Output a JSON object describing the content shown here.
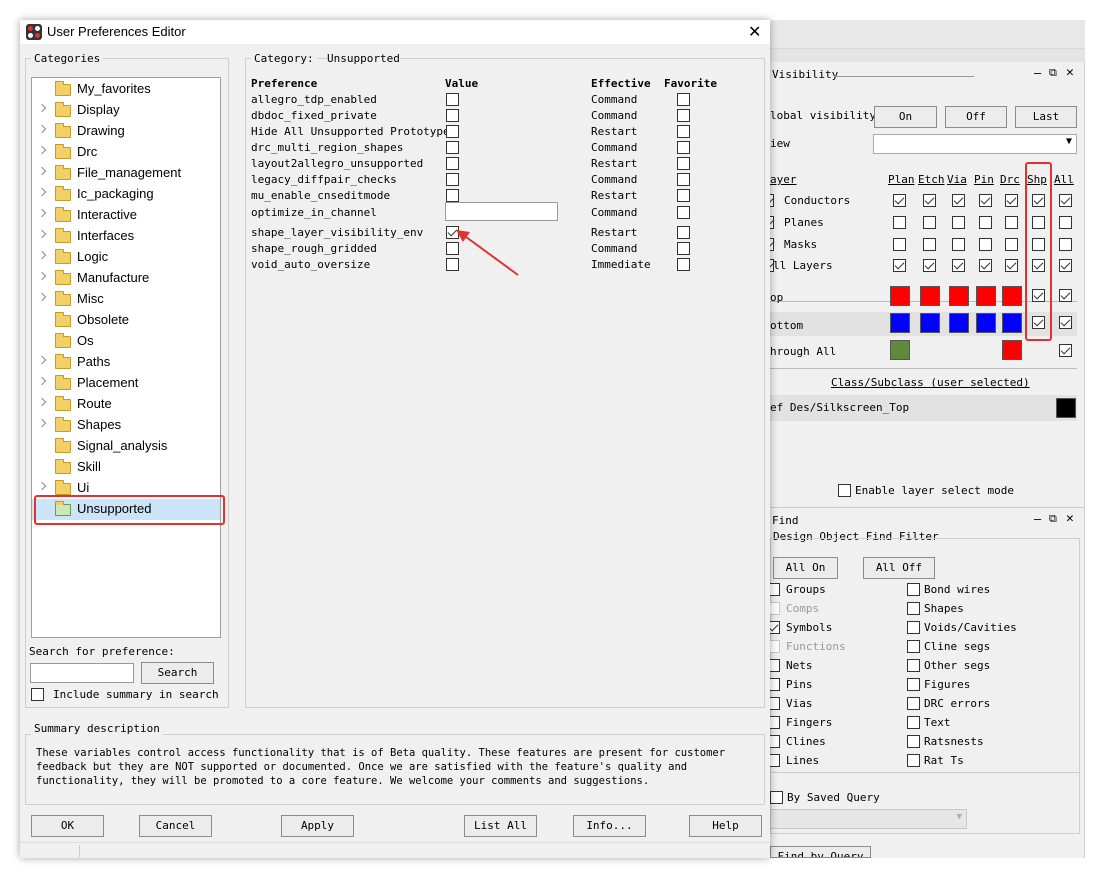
{
  "dialog": {
    "title": "User Preferences Editor",
    "categories_label": "Categories",
    "category_prefix": "Category:",
    "category_value": "Unsupported",
    "tree": [
      {
        "label": "My_favorites",
        "expandable": false
      },
      {
        "label": "Display",
        "expandable": true
      },
      {
        "label": "Drawing",
        "expandable": true
      },
      {
        "label": "Drc",
        "expandable": true
      },
      {
        "label": "File_management",
        "expandable": true
      },
      {
        "label": "Ic_packaging",
        "expandable": true
      },
      {
        "label": "Interactive",
        "expandable": true
      },
      {
        "label": "Interfaces",
        "expandable": true
      },
      {
        "label": "Logic",
        "expandable": true
      },
      {
        "label": "Manufacture",
        "expandable": true
      },
      {
        "label": "Misc",
        "expandable": true
      },
      {
        "label": "Obsolete",
        "expandable": false
      },
      {
        "label": "Os",
        "expandable": false
      },
      {
        "label": "Paths",
        "expandable": true
      },
      {
        "label": "Placement",
        "expandable": true
      },
      {
        "label": "Route",
        "expandable": true
      },
      {
        "label": "Shapes",
        "expandable": true
      },
      {
        "label": "Signal_analysis",
        "expandable": false
      },
      {
        "label": "Skill",
        "expandable": false
      },
      {
        "label": "Ui",
        "expandable": true
      },
      {
        "label": "Unsupported",
        "expandable": false,
        "selected": true
      }
    ],
    "columns": {
      "preference": "Preference",
      "value": "Value",
      "effective": "Effective",
      "favorite": "Favorite"
    },
    "preferences": [
      {
        "name": "allegro_tdp_enabled",
        "value_type": "checkbox",
        "checked": false,
        "effective": "Command"
      },
      {
        "name": "dbdoc_fixed_private",
        "value_type": "checkbox",
        "checked": false,
        "effective": "Command"
      },
      {
        "name": "Hide All Unsupported Prototypes",
        "value_type": "checkbox",
        "checked": false,
        "effective": "Restart"
      },
      {
        "name": "drc_multi_region_shapes",
        "value_type": "checkbox",
        "checked": false,
        "effective": "Command"
      },
      {
        "name": "layout2allegro_unsupported",
        "value_type": "checkbox",
        "checked": false,
        "effective": "Restart"
      },
      {
        "name": "legacy_diffpair_checks",
        "value_type": "checkbox",
        "checked": false,
        "effective": "Command"
      },
      {
        "name": "mu_enable_cnseditmode",
        "value_type": "checkbox",
        "checked": false,
        "effective": "Restart"
      },
      {
        "name": "optimize_in_channel",
        "value_type": "text",
        "value": "",
        "effective": "Command"
      },
      {
        "name": "shape_layer_visibility_env",
        "value_type": "checkbox",
        "checked": true,
        "effective": "Restart"
      },
      {
        "name": "shape_rough_gridded",
        "value_type": "checkbox",
        "checked": false,
        "effective": "Command"
      },
      {
        "name": "void_auto_oversize",
        "value_type": "checkbox",
        "checked": false,
        "effective": "Immediate"
      }
    ],
    "search_label": "Search for preference:",
    "search_value": "",
    "search_button": "Search",
    "include_summary_label": "Include summary in search",
    "summary_title": "Summary description",
    "summary_text": "These variables control access functionality that is of Beta quality. These features are present for customer\nfeedback but they are NOT supported or documented. Once we are satisfied with the feature's quality and\nfunctionality, they will be promoted to a core feature. We welcome your comments and suggestions.",
    "buttons": {
      "ok": "OK",
      "cancel": "Cancel",
      "apply": "Apply",
      "list_all": "List All",
      "info": "Info...",
      "help": "Help"
    }
  },
  "visibility": {
    "title": "Visibility",
    "global_label": "lobal visibility",
    "on": "On",
    "off": "Off",
    "last": "Last",
    "view_label": "iew",
    "layer_header": "ayer",
    "col_headers": [
      "Plan",
      "Etch",
      "Via",
      "Pin",
      "Drc",
      "Shp",
      "All"
    ],
    "rows": [
      {
        "label": "Conductors",
        "checks": [
          true,
          true,
          true,
          true,
          true,
          true,
          true
        ]
      },
      {
        "label": "Planes",
        "checks": [
          false,
          false,
          false,
          false,
          false,
          false,
          false
        ]
      },
      {
        "label": "Masks",
        "checks": [
          false,
          false,
          false,
          false,
          false,
          false,
          false
        ]
      },
      {
        "label": "ll Layers",
        "checks": [
          true,
          true,
          true,
          true,
          true,
          true,
          true
        ]
      }
    ],
    "top_label": "op",
    "bottom_label": "ottom",
    "through_label": "hrough All",
    "top_color": "#ff0000",
    "bottom_color": "#0000ff",
    "through_color": "#5f8a3c",
    "class_subclass": "Class/Subclass (user selected)",
    "ref_des": "ef Des/Silkscreen_Top",
    "enable_layer_select": "Enable layer select mode"
  },
  "find": {
    "title": "Find",
    "filter_title": "Design Object Find Filter",
    "all_on": "All On",
    "all_off": "All Off",
    "left_items": [
      {
        "label": "Groups",
        "checked": false,
        "disabled": false
      },
      {
        "label": "Comps",
        "checked": false,
        "disabled": true
      },
      {
        "label": "Symbols",
        "checked": true,
        "disabled": false
      },
      {
        "label": "Functions",
        "checked": false,
        "disabled": true
      },
      {
        "label": "Nets",
        "checked": false,
        "disabled": false
      },
      {
        "label": "Pins",
        "checked": false,
        "disabled": false
      },
      {
        "label": "Vias",
        "checked": false,
        "disabled": false
      },
      {
        "label": "Fingers",
        "checked": false,
        "disabled": false
      },
      {
        "label": "Clines",
        "checked": false,
        "disabled": false
      },
      {
        "label": "Lines",
        "checked": false,
        "disabled": false
      }
    ],
    "right_items": [
      {
        "label": "Bond wires",
        "checked": false
      },
      {
        "label": "Shapes",
        "checked": false
      },
      {
        "label": "Voids/Cavities",
        "checked": false
      },
      {
        "label": "Cline segs",
        "checked": false
      },
      {
        "label": "Other segs",
        "checked": false
      },
      {
        "label": "Figures",
        "checked": false
      },
      {
        "label": "DRC errors",
        "checked": false
      },
      {
        "label": "Text",
        "checked": false
      },
      {
        "label": "Ratsnests",
        "checked": false
      },
      {
        "label": "Rat Ts",
        "checked": false
      }
    ],
    "by_saved_query": "By Saved Query",
    "find_by_query": "Find by Query"
  }
}
